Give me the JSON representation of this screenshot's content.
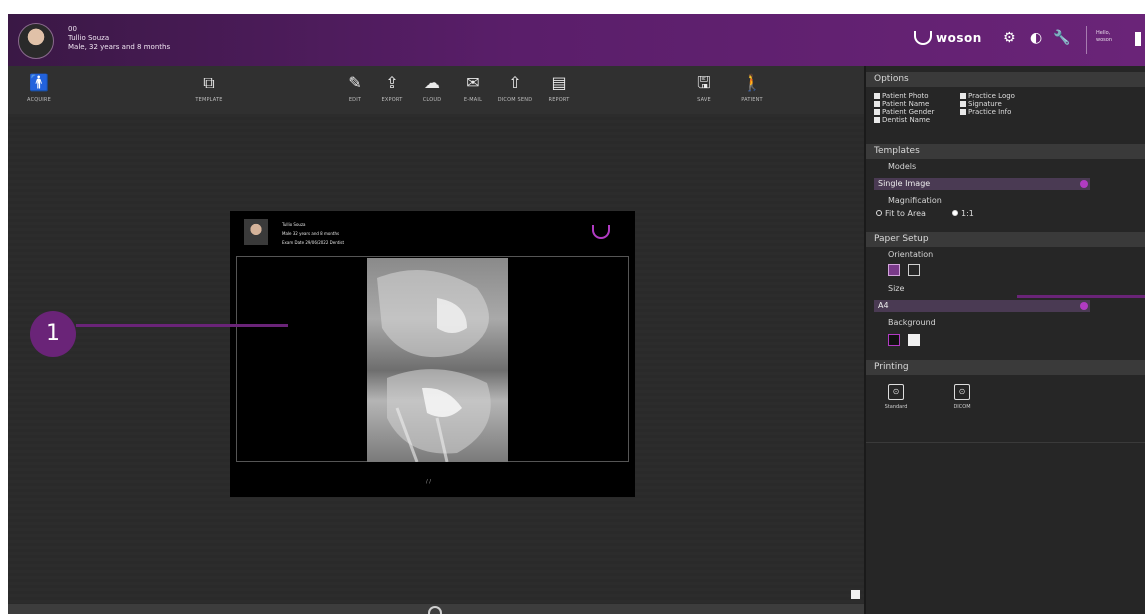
{
  "header": {
    "patient_id": "00",
    "patient_name": "Tullio Souza",
    "patient_details": "Male, 32 years and 8 months",
    "brand": "woson",
    "greeting_line1": "Hello,",
    "greeting_line2": "woson"
  },
  "toolbar": {
    "acquire": "ACQUIRE",
    "template": "TEMPLATE",
    "edit": "EDIT",
    "export": "EXPORT",
    "cloud": "CLOUD",
    "email": "E-MAIL",
    "dicom_send": "DICOM SEND",
    "report": "REPORT",
    "save": "SAVE",
    "patient": "PATIENT"
  },
  "preview": {
    "name": "Tullio Souza",
    "details": "Male  32 years and 8 months",
    "exam": "Exam Date  29/06/2022  Dentist",
    "pages": "/ /"
  },
  "callout": {
    "number": "1"
  },
  "panel": {
    "options": {
      "title": "Options",
      "items": [
        {
          "label": "Patient Photo",
          "checked": true
        },
        {
          "label": "Practice Logo",
          "checked": true
        },
        {
          "label": "Patient Name",
          "checked": true
        },
        {
          "label": "Signature",
          "checked": true
        },
        {
          "label": "Patient Gender",
          "checked": true
        },
        {
          "label": "Practice Info",
          "checked": true
        },
        {
          "label": "Dentist Name",
          "checked": true
        }
      ]
    },
    "templates": {
      "title": "Templates",
      "models_label": "Models",
      "model_value": "Single Image",
      "magnification_label": "Magnification",
      "fit_to_area": "Fit to Area",
      "one_to_one": "1:1",
      "selected": "1:1"
    },
    "paper": {
      "title": "Paper Setup",
      "orientation_label": "Orientation",
      "orientation_selected": "landscape",
      "size_label": "Size",
      "size_value": "A4",
      "background_label": "Background",
      "background_selected": "black"
    },
    "printing": {
      "title": "Printing",
      "standard": "Standard",
      "dicom": "DICOM"
    }
  },
  "colors": {
    "accent": "#6a2478",
    "accent_bright": "#b13bc3",
    "header": "#5a1e6a",
    "background": "#2b2b2b"
  }
}
